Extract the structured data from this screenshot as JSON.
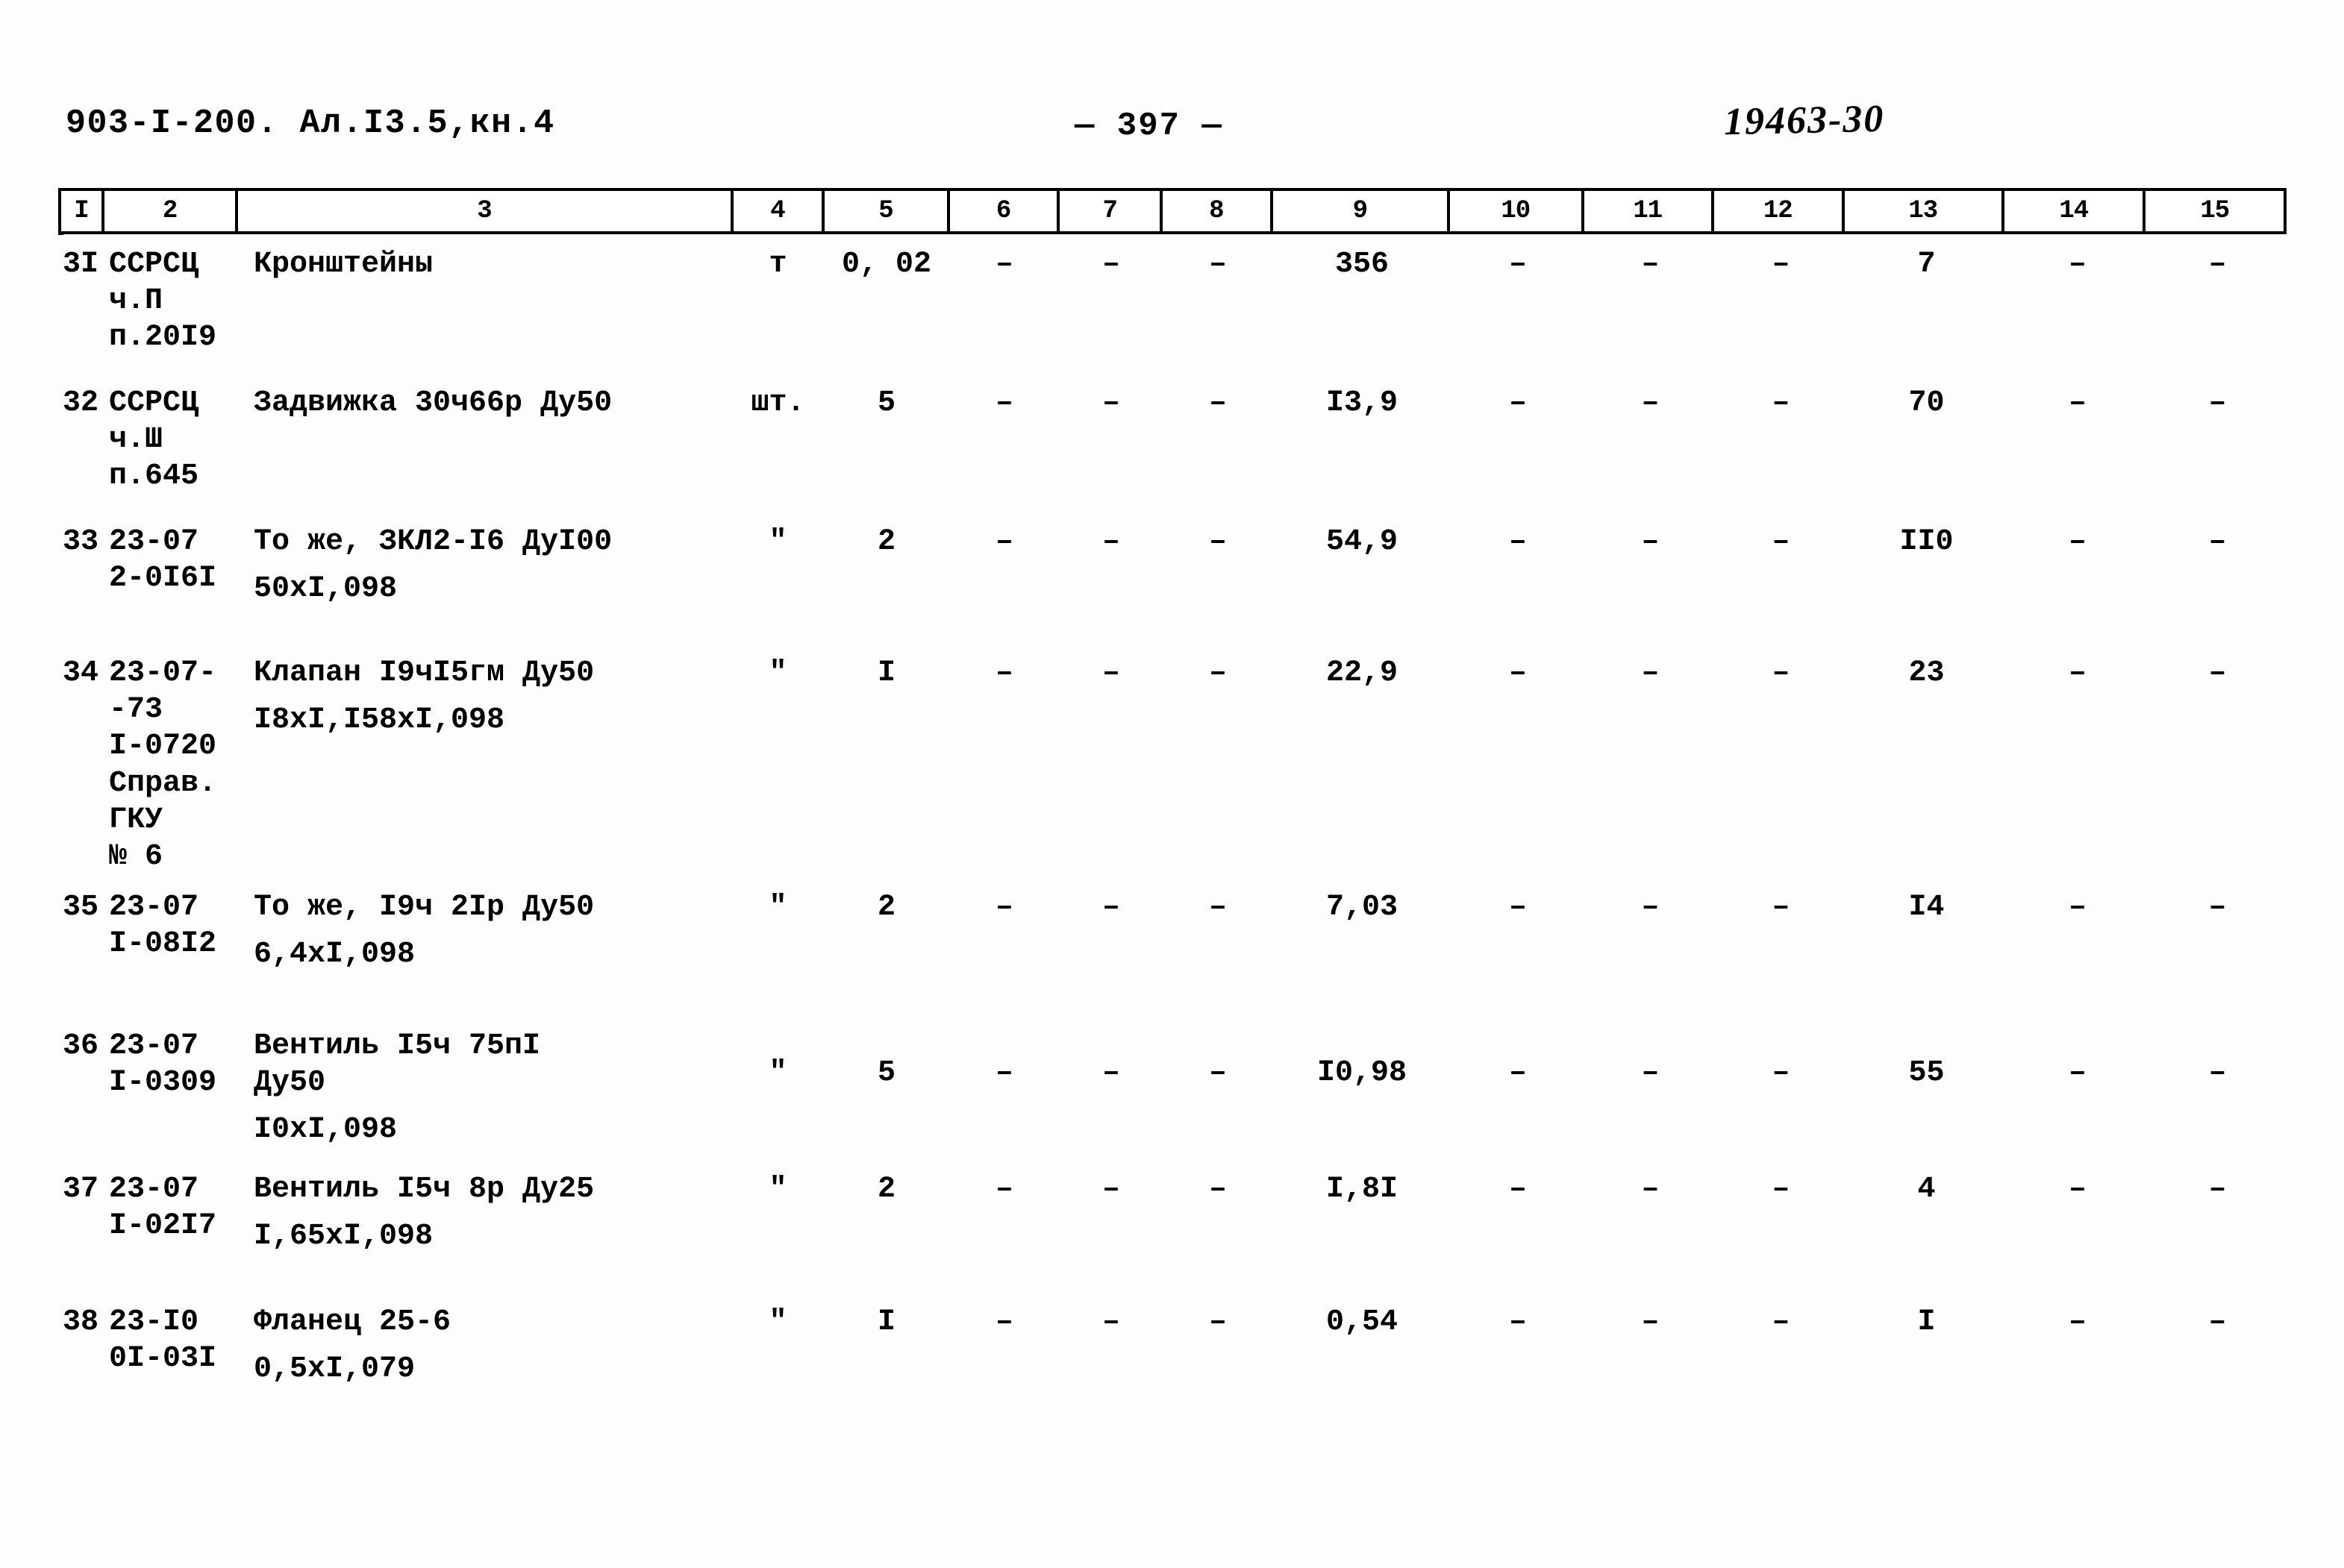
{
  "header": {
    "doc_code": "903-I-200. Ал.I3.5,кн.4",
    "page_label": "— 397 —",
    "stamp_number": "19463-30"
  },
  "table": {
    "column_headers": [
      "I",
      "2",
      "3",
      "4",
      "5",
      "6",
      "7",
      "8",
      "9",
      "10",
      "11",
      "12",
      "13",
      "14",
      "15"
    ],
    "dash": "–",
    "rows": [
      {
        "num": "3I",
        "code": "ССРСЦ\nч.П\nп.20I9",
        "desc": "Кронштейны",
        "unit": "т",
        "c5": "0, 02",
        "c6": "–",
        "c7": "–",
        "c8": "–",
        "c9": "356",
        "c10": "–",
        "c11": "–",
        "c12": "–",
        "c13": "7",
        "c14": "–",
        "c15": "–"
      },
      {
        "num": "32",
        "code": "ССРСЦ\nч.Ш\nп.645",
        "desc": "Задвижка 30ч66р Ду50",
        "unit": "шт.",
        "c5": "5",
        "c6": "–",
        "c7": "–",
        "c8": "–",
        "c9": "I3,9",
        "c10": "–",
        "c11": "–",
        "c12": "–",
        "c13": "70",
        "c14": "–",
        "c15": "–"
      },
      {
        "num": "33",
        "code": "23-07\n2-0I6I",
        "desc": "То же, ЗКЛ2-I6 ДуI00",
        "desc2": "50xI,098",
        "unit": "\"",
        "c5": "2",
        "c6": "–",
        "c7": "–",
        "c8": "–",
        "c9": "54,9",
        "c10": "–",
        "c11": "–",
        "c12": "–",
        "c13": "II0",
        "c14": "–",
        "c15": "–"
      },
      {
        "num": "34",
        "code": "23-07-\n-73\nI-0720\nСправ.\nГКУ\n№ 6",
        "desc": "Клапан I9чI5гм Ду50",
        "desc2": "I8xI,I58xI,098",
        "unit": "\"",
        "c5": "I",
        "c6": "–",
        "c7": "–",
        "c8": "–",
        "c9": "22,9",
        "c10": "–",
        "c11": "–",
        "c12": "–",
        "c13": "23",
        "c14": "–",
        "c15": "–"
      },
      {
        "num": "35",
        "code": "23-07\nI-08I2",
        "desc": "То же, I9ч 2Iр Ду50",
        "desc2": "6,4xI,098",
        "unit": "\"",
        "c5": "2",
        "c6": "–",
        "c7": "–",
        "c8": "–",
        "c9": "7,03",
        "c10": "–",
        "c11": "–",
        "c12": "–",
        "c13": "I4",
        "c14": "–",
        "c15": "–"
      },
      {
        "num": "36",
        "code": "23-07\nI-0309",
        "desc": "Вентиль I5ч 75пI\nДу50",
        "desc2": "I0xI,098",
        "unit": "\"",
        "c5": "5",
        "c6": "–",
        "c7": "–",
        "c8": "–",
        "c9": "I0,98",
        "c10": "–",
        "c11": "–",
        "c12": "–",
        "c13": "55",
        "c14": "–",
        "c15": "–"
      },
      {
        "num": "37",
        "code": "23-07\nI-02I7",
        "desc": "Вентиль I5ч 8р Ду25",
        "desc2": "I,65xI,098",
        "unit": "\"",
        "c5": "2",
        "c6": "–",
        "c7": "–",
        "c8": "–",
        "c9": "I,8I",
        "c10": "–",
        "c11": "–",
        "c12": "–",
        "c13": "4",
        "c14": "–",
        "c15": "–"
      },
      {
        "num": "38",
        "code": "23-I0\n0I-03I",
        "desc": "Фланец 25-6",
        "desc2": "0,5xI,079",
        "unit": "\"",
        "c5": "I",
        "c6": "–",
        "c7": "–",
        "c8": "–",
        "c9": "0,54",
        "c10": "–",
        "c11": "–",
        "c12": "–",
        "c13": "I",
        "c14": "–",
        "c15": "–"
      }
    ]
  }
}
